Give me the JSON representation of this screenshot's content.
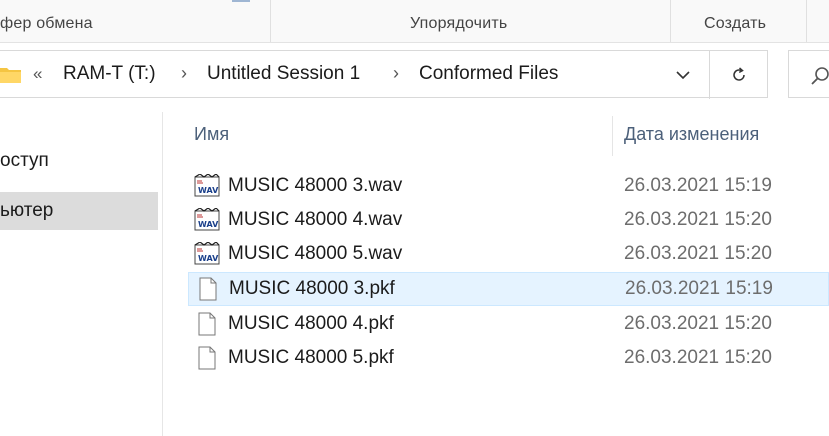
{
  "ribbon": {
    "groups": [
      "фер обмена",
      "Упорядочить",
      "Создать"
    ]
  },
  "address": {
    "overflow": "«",
    "crumbs": [
      "RAM-T (T:)",
      "Untitled Session 1",
      "Conformed Files"
    ],
    "separator": "›"
  },
  "nav": {
    "items": [
      "оступ",
      "ьютер"
    ]
  },
  "columns": {
    "name": "Имя",
    "date": "Дата изменения"
  },
  "files": [
    {
      "name": "MUSIC 48000 3.wav",
      "date": "26.03.2021 15:19",
      "icon": "wav-audio-file-icon"
    },
    {
      "name": "MUSIC 48000 4.wav",
      "date": "26.03.2021 15:20",
      "icon": "wav-audio-file-icon"
    },
    {
      "name": "MUSIC 48000 5.wav",
      "date": "26.03.2021 15:20",
      "icon": "wav-audio-file-icon"
    },
    {
      "name": "MUSIC 48000 3.pkf",
      "date": "26.03.2021 15:19",
      "icon": "blank-file-icon"
    },
    {
      "name": "MUSIC 48000 4.pkf",
      "date": "26.03.2021 15:20",
      "icon": "blank-file-icon"
    },
    {
      "name": "MUSIC 48000 5.pkf",
      "date": "26.03.2021 15:20",
      "icon": "blank-file-icon"
    }
  ],
  "colors": {
    "hover_row": "#e5f3ff",
    "selected_nav": "#dcdcdc",
    "folder": "#f5c542"
  }
}
